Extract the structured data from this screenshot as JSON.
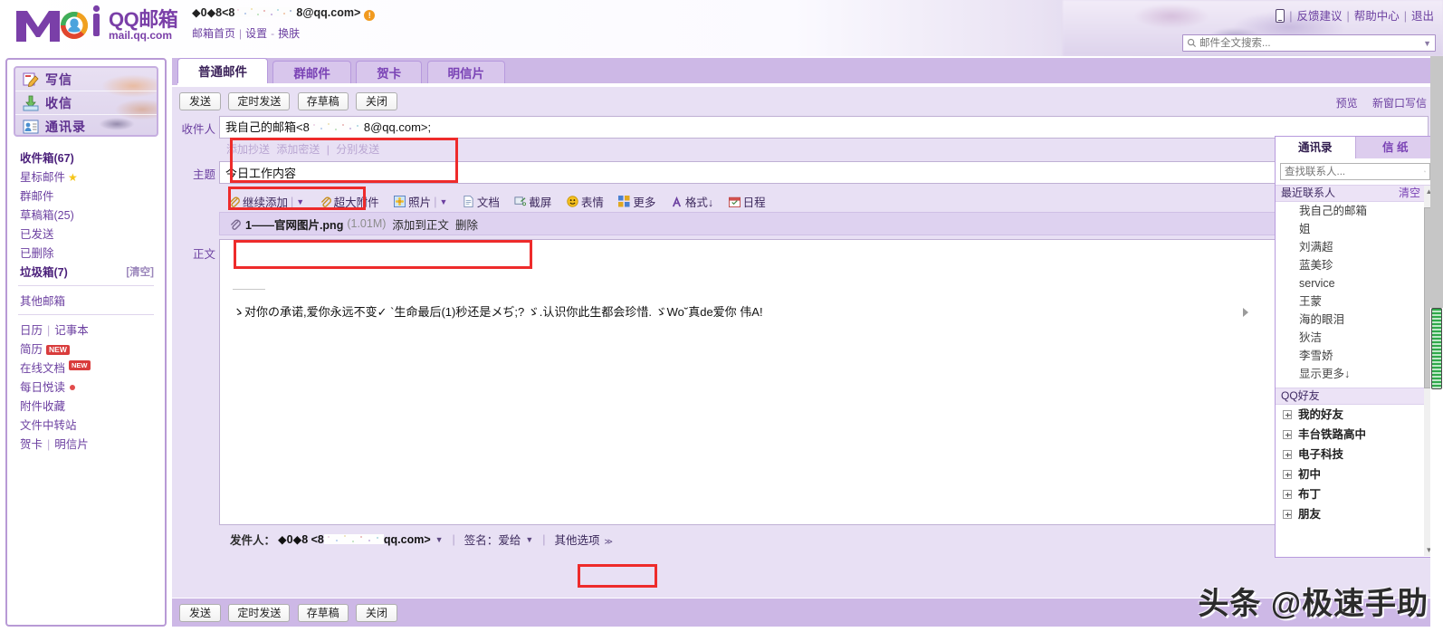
{
  "header": {
    "logo": {
      "brand_cn": "QQ邮箱",
      "brand_url": "mail.qq.com",
      "mark": "Mail"
    },
    "account_address": "◆0◆8<8",
    "account_address_tail": "8@qq.com>",
    "warn_icon": "warning-icon",
    "sublinks": {
      "home": "邮箱首页",
      "settings": "设置",
      "skin": "换肤",
      "sep": "|",
      "dash": "-"
    },
    "right_links": {
      "mobile_icon": "mobile-phone-icon",
      "feedback": "反馈建议",
      "help": "帮助中心",
      "logout": "退出",
      "sep": "|"
    },
    "search": {
      "placeholder": "邮件全文搜索...",
      "icon": "search-icon",
      "caret": "▼"
    }
  },
  "sidebar": {
    "actions": [
      {
        "label": "写信",
        "icon": "compose-pencil-icon"
      },
      {
        "label": "收信",
        "icon": "inbox-download-icon"
      },
      {
        "label": "通讯录",
        "icon": "address-book-icon"
      }
    ],
    "folders": [
      {
        "label": "收件箱(67)",
        "bold": true,
        "right": "",
        "star": false
      },
      {
        "label": "星标邮件",
        "bold": false,
        "right": "",
        "star": true
      },
      {
        "label": "群邮件",
        "bold": false,
        "right": "",
        "star": false
      },
      {
        "label": "草稿箱(25)",
        "bold": false,
        "right": "",
        "star": false
      },
      {
        "label": "已发送",
        "bold": false,
        "right": "",
        "star": false
      },
      {
        "label": "已删除",
        "bold": false,
        "right": "",
        "star": false
      },
      {
        "label": "垃圾箱(7)",
        "bold": true,
        "right": "[清空]",
        "star": false
      }
    ],
    "other_mailbox": "其他邮箱",
    "tools": {
      "calendar": "日历",
      "notepad": "记事本",
      "resume": "简历",
      "resume_badge": "NEW",
      "online_doc": "在线文档",
      "online_doc_badge": "NEW",
      "daily_read": "每日悦读",
      "attach_fav": "附件收藏",
      "file_relay": "文件中转站",
      "card": "贺卡",
      "postcard": "明信片",
      "sep": "|"
    }
  },
  "main": {
    "tabs": [
      {
        "label": "普通邮件",
        "active": true
      },
      {
        "label": "群邮件",
        "active": false
      },
      {
        "label": "贺卡",
        "active": false
      },
      {
        "label": "明信片",
        "active": false
      }
    ],
    "action_buttons": [
      "发送",
      "定时发送",
      "存草稿",
      "关闭"
    ],
    "top_right_links": [
      "预览",
      "新窗口写信"
    ],
    "form": {
      "to_label": "收件人",
      "to_value_name": "我自己的邮箱",
      "to_value_lt": "<8",
      "to_value_tail": "8@qq.com>;",
      "cc_links": [
        "添加抄送",
        "添加密送",
        "分别发送"
      ],
      "cc_sep": "|",
      "subject_label": "主题",
      "subject_value": "今日工作内容",
      "subject_grid_icon": "color-grid-icon",
      "body_label": "正文"
    },
    "attach_toolbar": [
      {
        "label": "继续添加",
        "icon": "paperclip-icon",
        "bar": "|",
        "caret": "▼"
      },
      {
        "label": "超大附件",
        "icon": "paperclip-icon",
        "bar": "",
        "caret": ""
      },
      {
        "label": "照片",
        "icon": "photo-sunflower-icon",
        "bar": "|",
        "caret": "▼"
      },
      {
        "label": "文档",
        "icon": "document-icon",
        "bar": "",
        "caret": ""
      },
      {
        "label": "截屏",
        "icon": "screenshot-icon",
        "bar": "",
        "caret": ""
      },
      {
        "label": "表情",
        "icon": "smiley-icon",
        "bar": "",
        "caret": ""
      },
      {
        "label": "更多",
        "icon": "more-grid-icon",
        "bar": "",
        "caret": ""
      },
      {
        "label": "格式↓",
        "icon": "format-A-icon",
        "bar": "",
        "caret": ""
      },
      {
        "label": "日程",
        "icon": "calendar-icon",
        "bar": "",
        "caret": ""
      }
    ],
    "attachment": {
      "icon": "paperclip-icon",
      "filename": "1——官网图片.png",
      "size": "(1.01M)",
      "insert_action": "添加到正文",
      "delete_action": "删除"
    },
    "signature_text": "ゝ对你の承诺,爱你永远不变✓  `生命最后(1)秒还是メぢ;?   ゞ.认识你此生都会珍惜. ゞWo˘真de爱你    伟A!",
    "footer": {
      "from_label": "发件人：",
      "from_value": "◆0◆8 <8",
      "from_tail": "qq.com>",
      "from_caret": "▼",
      "sig_label": "签名：",
      "sig_value": "爱给",
      "sig_caret": "▼",
      "more_options": "其他选项",
      "more_caret": "≫",
      "divider": "|"
    },
    "bottom_buttons": [
      "发送",
      "定时发送",
      "存草稿",
      "关闭"
    ]
  },
  "right_panel": {
    "tabs": [
      {
        "label": "通讯录",
        "active": true
      },
      {
        "label": "信 纸",
        "active": false
      }
    ],
    "search_placeholder": "查找联系人...",
    "search_icon": "search-icon",
    "recent_header": "最近联系人",
    "recent_clear": "清空",
    "recent_contacts": [
      "我自己的邮箱",
      "姐",
      "刘满超",
      "蓝美珍",
      "service",
      "王蒙",
      "海的眼泪",
      "狄洁",
      "李雪娇",
      "显示更多↓"
    ],
    "qq_friends_header": "QQ好友",
    "qq_groups": [
      "我的好友",
      "丰台铁路高中",
      "电子科技",
      "初中",
      "布丁",
      "朋友"
    ],
    "scroll_up": "▲",
    "scroll_down": "▼"
  },
  "watermark": "头条 @极速手助",
  "colors": {
    "accent_purple": "#7a43b5",
    "panel_purple": "#cdb8e6",
    "light_purple": "#e8e0f4",
    "annotation_red": "#ee2b2b",
    "badge_red": "#d93c3c",
    "warn_orange": "#f19a1f"
  }
}
